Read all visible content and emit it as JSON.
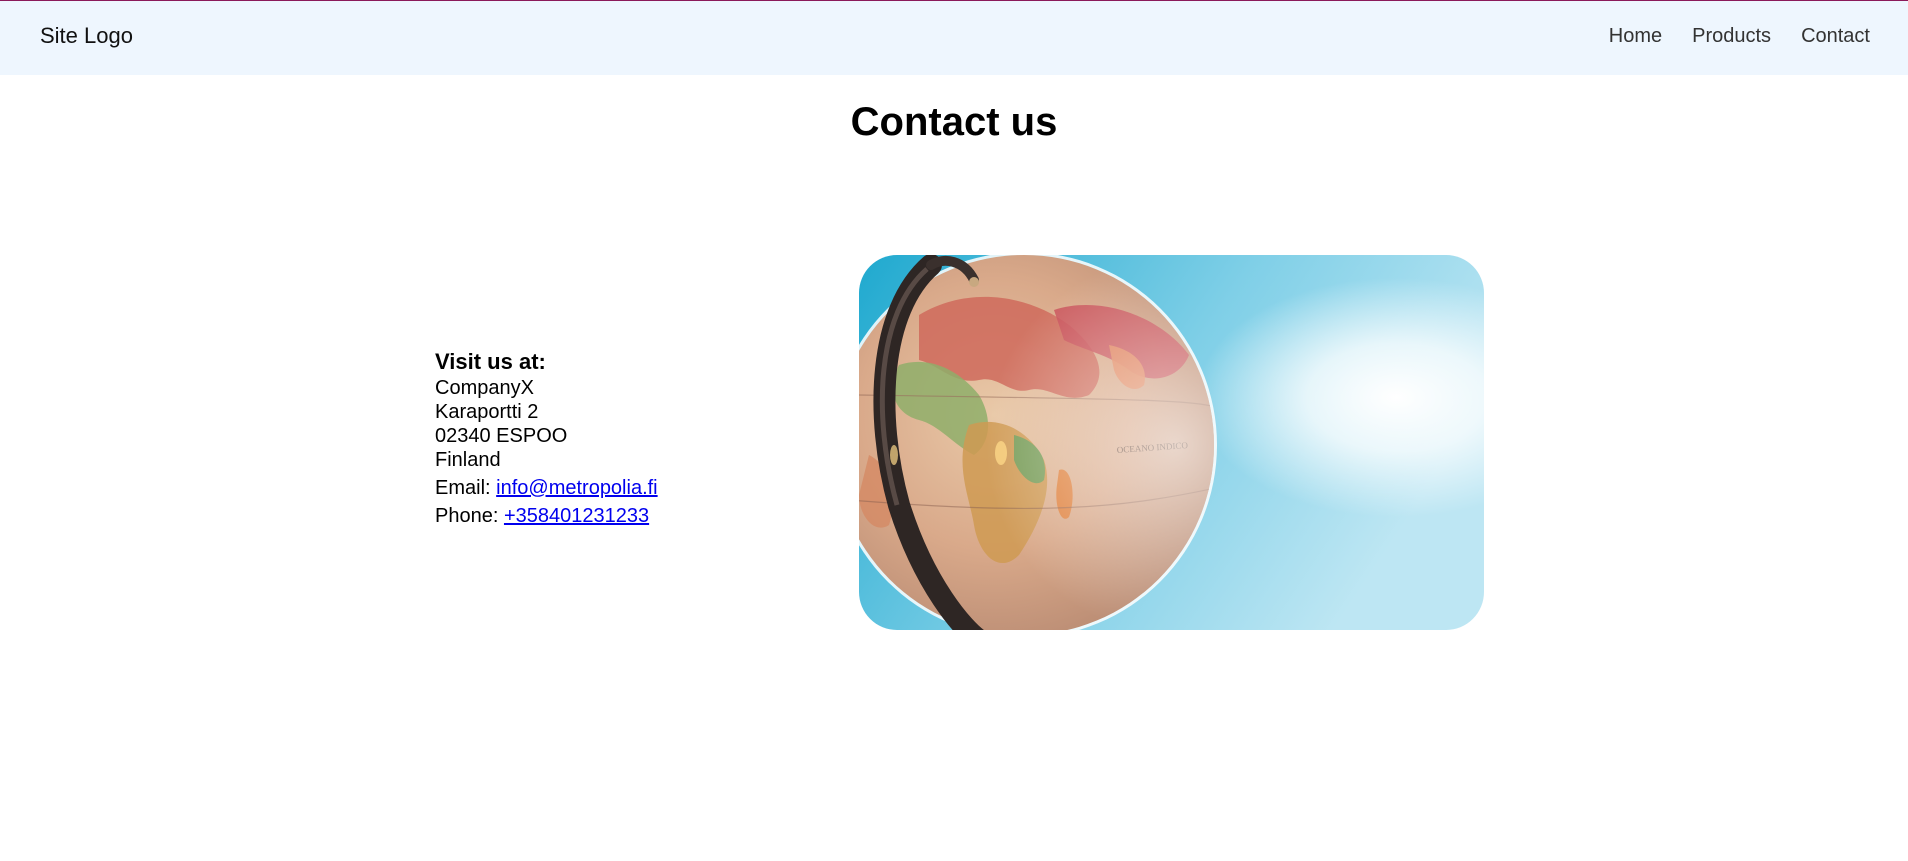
{
  "header": {
    "logo": "Site Logo",
    "nav": [
      {
        "label": "Home"
      },
      {
        "label": "Products"
      },
      {
        "label": "Contact"
      }
    ]
  },
  "main": {
    "title": "Contact us",
    "contact": {
      "heading": "Visit us at:",
      "company": "CompanyX",
      "street": "Karaportti 2",
      "postal": "02340 ESPOO",
      "country": "Finland",
      "email_label": "Email:",
      "email": "info@metropolia.fi",
      "phone_label": "Phone:",
      "phone": "+358401231233"
    },
    "image": {
      "subject": "globe on stand against blue sky",
      "globe_text": "OCEANO INDICO"
    }
  },
  "colors": {
    "navbar_bg": "#eef6fe",
    "top_border": "#8a1a5a",
    "link": "#0000ee"
  }
}
